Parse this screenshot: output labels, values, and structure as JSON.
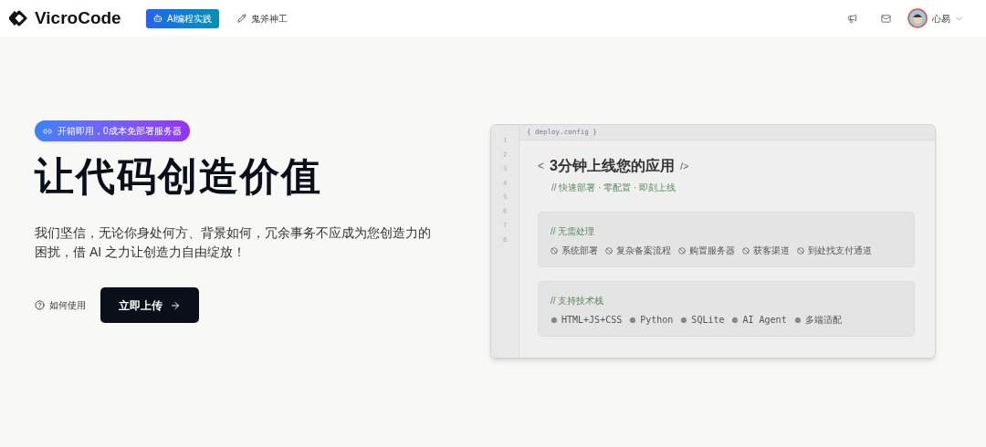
{
  "nav": {
    "logo": "VicroCode",
    "links": [
      {
        "label": "AI编程实践",
        "selected": true
      },
      {
        "label": "鬼斧神工",
        "selected": false
      }
    ],
    "user": "心易"
  },
  "hero": {
    "badge": "开箱即用，0成本免部署服务器",
    "title": "让代码创造价值",
    "description": "我们坚信，无论你身处何方、背景如何，冗余事务不应成为您创造力的困扰，借 AI 之力让创造力自由绽放！",
    "help": "如何使用",
    "cta": "立即上传"
  },
  "editor": {
    "tab": "{ deploy.config }",
    "line_numbers": [
      "1",
      "2",
      "3",
      "4",
      "5",
      "6",
      "7",
      "8"
    ],
    "open_tag": "<",
    "heading": "3分钟上线您的应用",
    "close_tag": "/>",
    "subtitle": "// 快速部署 · 零配置 · 即刻上线",
    "sections": [
      {
        "comment": "// 无需处理",
        "items": [
          {
            "label": "系统部署",
            "kind": "blocked"
          },
          {
            "label": "复杂备案流程",
            "kind": "blocked"
          },
          {
            "label": "购置服务器",
            "kind": "blocked"
          },
          {
            "label": "获客渠道",
            "kind": "blocked"
          },
          {
            "label": "到处找支付通道",
            "kind": "blocked"
          }
        ]
      },
      {
        "comment": "// 支持技术栈",
        "items": [
          {
            "label": "HTML+JS+CSS",
            "kind": "supported"
          },
          {
            "label": "Python",
            "kind": "supported"
          },
          {
            "label": "SQLite",
            "kind": "supported"
          },
          {
            "label": "AI Agent",
            "kind": "supported"
          },
          {
            "label": "多端适配",
            "kind": "supported"
          }
        ]
      }
    ]
  }
}
